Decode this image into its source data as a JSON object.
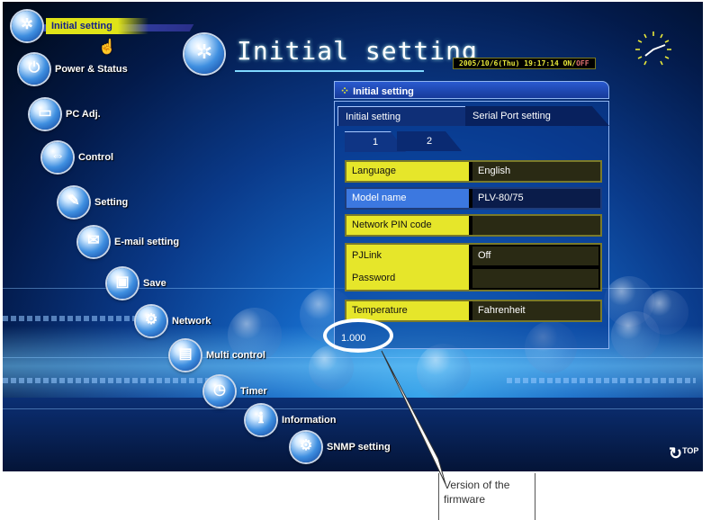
{
  "menu": [
    {
      "id": "initial",
      "label": "Initial setting",
      "active": true,
      "icon": "gear-icon"
    },
    {
      "id": "power",
      "label": "Power & Status",
      "icon": "power-icon"
    },
    {
      "id": "pcadj",
      "label": "PC Adj.",
      "icon": "monitor-icon"
    },
    {
      "id": "control",
      "label": "Control",
      "icon": "arrows-icon"
    },
    {
      "id": "setting",
      "label": "Setting",
      "icon": "wrench-icon"
    },
    {
      "id": "email",
      "label": "E-mail setting",
      "icon": "envelope-icon"
    },
    {
      "id": "save",
      "label": "Save",
      "icon": "disk-icon"
    },
    {
      "id": "network",
      "label": "Network",
      "icon": "network-icon"
    },
    {
      "id": "multi",
      "label": "Multi control",
      "icon": "projector-icon"
    },
    {
      "id": "timer",
      "label": "Timer",
      "icon": "clock-icon"
    },
    {
      "id": "information",
      "label": "Information",
      "icon": "info-icon"
    },
    {
      "id": "snmp",
      "label": "SNMP setting",
      "icon": "snmp-icon"
    }
  ],
  "header": {
    "title": "Initial setting",
    "datetime": "2005/10/6(Thu)  19:17:14",
    "on_label": "ON/",
    "off_label": "OFF"
  },
  "panel": {
    "title": "Initial setting",
    "tabs": [
      "Initial setting",
      "Serial Port setting"
    ],
    "subtabs": [
      "1",
      "2"
    ],
    "rows": [
      {
        "label": "Language",
        "value": "English"
      },
      {
        "label": "Model name",
        "value": "PLV-80/75"
      },
      {
        "label": "Network PIN code",
        "value": ""
      },
      {
        "label": "PJLink",
        "value": "Off"
      },
      {
        "label": "Password",
        "value": ""
      },
      {
        "label": "Temperature",
        "value": "Fahrenheit"
      }
    ],
    "version": "1.000"
  },
  "top_button": "TOP",
  "callout": "Version of the firmware",
  "colors": {
    "accent_yellow": "#e6e62a",
    "panel_blue": "#163a99",
    "highlight_blue": "#3c78e0"
  }
}
